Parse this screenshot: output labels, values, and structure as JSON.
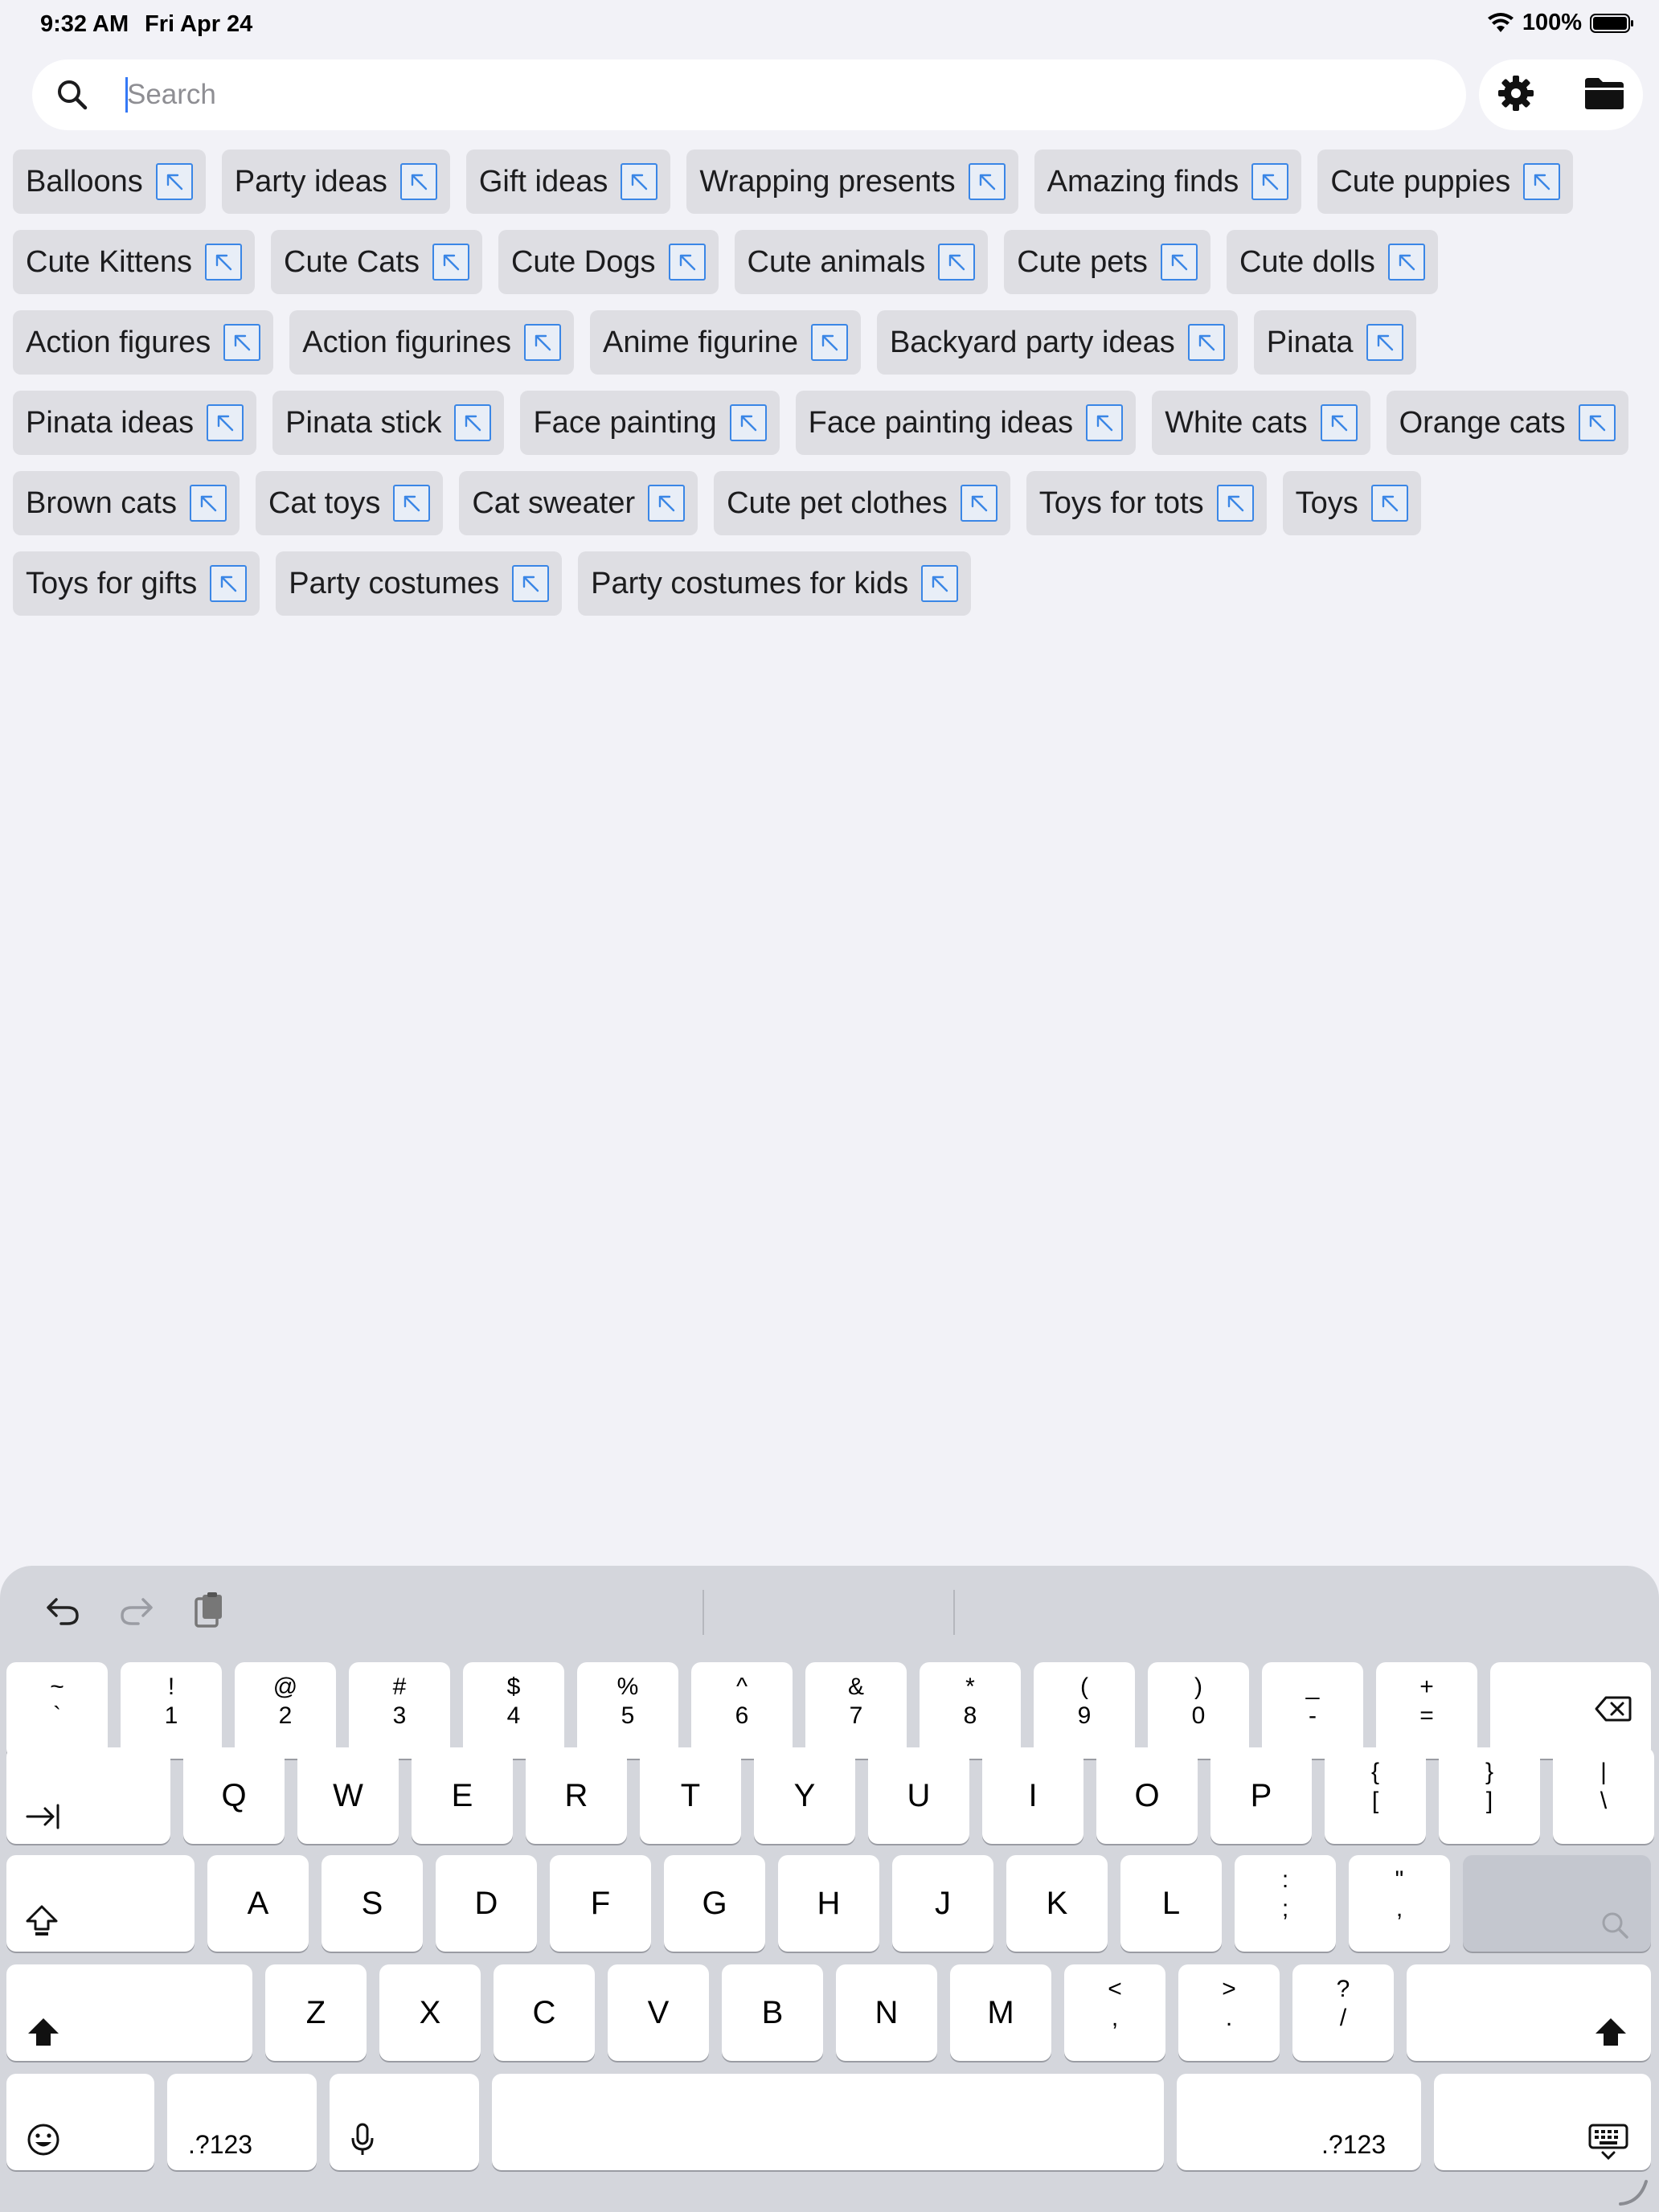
{
  "status": {
    "time": "9:32 AM",
    "date": "Fri Apr 24",
    "battery": "100%"
  },
  "search": {
    "placeholder": "Search",
    "value": ""
  },
  "actions": {
    "settings_icon": "gear-icon",
    "folder_icon": "folder-icon"
  },
  "chips": [
    "Balloons",
    "Party ideas",
    "Gift ideas",
    "Wrapping presents",
    "Amazing finds",
    "Cute puppies",
    "Cute Kittens",
    "Cute Cats",
    "Cute Dogs",
    "Cute animals",
    "Cute pets",
    "Cute dolls",
    "Action figures",
    "Action figurines",
    "Anime figurine",
    "Backyard party ideas",
    "Pinata",
    "Pinata ideas",
    "Pinata stick",
    "Face painting",
    "Face painting ideas",
    "White cats",
    "Orange cats",
    "Brown cats",
    "Cat toys",
    "Cat sweater",
    "Cute pet clothes",
    "Toys for tots",
    "Toys",
    "Toys for gifts",
    "Party costumes",
    "Party costumes for kids"
  ],
  "keyboard": {
    "number_row": [
      {
        "top": "~",
        "bot": "`"
      },
      {
        "top": "!",
        "bot": "1"
      },
      {
        "top": "@",
        "bot": "2"
      },
      {
        "top": "#",
        "bot": "3"
      },
      {
        "top": "$",
        "bot": "4"
      },
      {
        "top": "%",
        "bot": "5"
      },
      {
        "top": "^",
        "bot": "6"
      },
      {
        "top": "&",
        "bot": "7"
      },
      {
        "top": "*",
        "bot": "8"
      },
      {
        "top": "(",
        "bot": "9"
      },
      {
        "top": ")",
        "bot": "0"
      },
      {
        "top": "_",
        "bot": "-"
      },
      {
        "top": "+",
        "bot": "="
      }
    ],
    "row_q": [
      "Q",
      "W",
      "E",
      "R",
      "T",
      "Y",
      "U",
      "I",
      "O",
      "P"
    ],
    "row_q_sym": [
      {
        "top": "{",
        "bot": "["
      },
      {
        "top": "}",
        "bot": "]"
      },
      {
        "top": "|",
        "bot": "\\"
      }
    ],
    "row_a": [
      "A",
      "S",
      "D",
      "F",
      "G",
      "H",
      "J",
      "K",
      "L"
    ],
    "row_a_sym": [
      {
        "top": ":",
        "bot": ";"
      },
      {
        "top": "\"",
        "bot": ","
      }
    ],
    "row_z": [
      "Z",
      "X",
      "C",
      "V",
      "B",
      "N",
      "M"
    ],
    "row_z_sym": [
      {
        "top": "<",
        "bot": ","
      },
      {
        "top": ">",
        "bot": "."
      },
      {
        "top": "?",
        "bot": "/"
      }
    ],
    "num_switch_left": ".?123",
    "num_switch_right": ".?123"
  }
}
